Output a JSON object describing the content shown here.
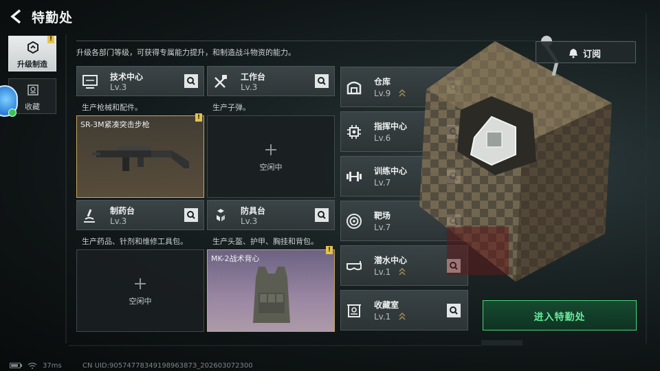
{
  "header": {
    "title": "特勤处"
  },
  "sidebar": {
    "items": [
      {
        "label": "升级制造",
        "active": true,
        "badge": "!"
      },
      {
        "label": "收藏",
        "active": false
      }
    ]
  },
  "description": "升级各部门等级，可获得专属能力提升，和制造战斗物资的能力。",
  "subscribe_label": "订阅",
  "enter_label": "进入特勤处",
  "workshops": [
    {
      "name": "技术中心",
      "level": "Lv.3",
      "desc": "生产枪械和配件。",
      "slot_item": "SR-3M紧凑突击步枪",
      "slot_state": "item",
      "warn": "!"
    },
    {
      "name": "工作台",
      "level": "Lv.3",
      "desc": "生产子弹。",
      "slot_item": "",
      "slot_state": "idle",
      "idle_label": "空闲中"
    },
    {
      "name": "制药台",
      "level": "Lv.3",
      "desc": "生产药品、针剂和维修工具包。",
      "slot_item": "",
      "slot_state": "idle",
      "idle_label": "空闲中"
    },
    {
      "name": "防具台",
      "level": "Lv.3",
      "desc": "生产头盔、护甲、胸挂和背包。",
      "slot_item": "MK-2战术背心",
      "slot_state": "item",
      "warn": "!"
    }
  ],
  "departments": [
    {
      "name": "仓库",
      "level": "Lv.9",
      "icon": "warehouse-icon",
      "upgradable": true
    },
    {
      "name": "指挥中心",
      "level": "Lv.6",
      "icon": "command-chip-icon",
      "upgradable": false
    },
    {
      "name": "训练中心",
      "level": "Lv.7",
      "icon": "dumbbell-icon",
      "upgradable": false
    },
    {
      "name": "靶场",
      "level": "Lv.7",
      "icon": "target-icon",
      "upgradable": false
    },
    {
      "name": "潜水中心",
      "level": "Lv.1",
      "icon": "diving-mask-icon",
      "upgradable": true
    },
    {
      "name": "收藏室",
      "level": "Lv.1",
      "icon": "collection-room-icon",
      "upgradable": true
    }
  ],
  "footer": {
    "ping": "37ms",
    "uid": "CN UID:9057477834919896387З_202603072300"
  },
  "colors": {
    "accent_green": "#68e99a",
    "warn_yellow": "#e6c24a",
    "slot_gold": "#c9a55a"
  }
}
